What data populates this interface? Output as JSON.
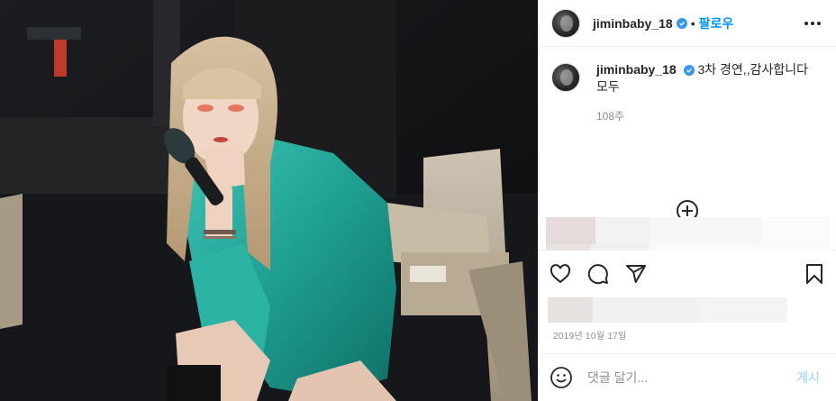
{
  "post": {
    "username": "jiminbaby_18",
    "follow_separator": "•",
    "follow_label": "팔로우",
    "caption": "3차 경연,,감사합니다 모두",
    "time_ago": "108주",
    "date": "2019년 10월 17일",
    "comment_placeholder": "댓글 달기...",
    "post_label": "게시"
  },
  "colors": {
    "accent": "#0095f6",
    "verified": "#3897f0",
    "muted": "#8e8e8e",
    "post_disabled": "#b2dffc"
  },
  "icons": {
    "more": "more-options-icon",
    "verified": "verified-badge-icon",
    "load_more": "plus-circle-icon",
    "like": "heart-icon",
    "comment": "comment-bubble-icon",
    "share": "paper-plane-icon",
    "save": "bookmark-icon",
    "emoji": "emoji-smile-icon"
  }
}
